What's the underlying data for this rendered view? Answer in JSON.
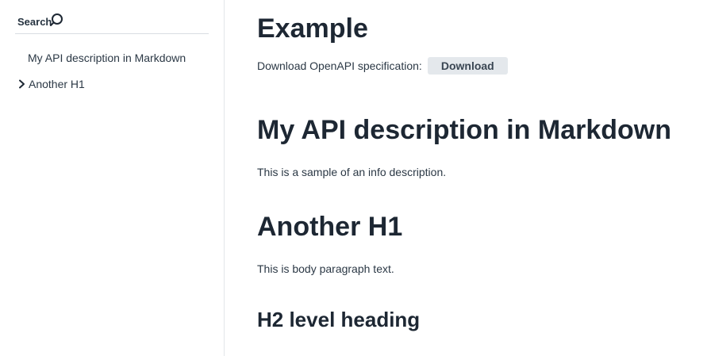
{
  "sidebar": {
    "search_label": "Search",
    "search_icon": "search-icon",
    "items": [
      {
        "label": "My API description in Markdown",
        "expandable": false
      },
      {
        "label": "Another H1",
        "expandable": true,
        "icon": "chevron-right-icon"
      }
    ]
  },
  "main": {
    "title": "Example",
    "download_text": "Download OpenAPI specification:",
    "download_button": "Download",
    "sections": [
      {
        "heading": "My API description in Markdown",
        "body": "This is a sample of an info description."
      },
      {
        "heading": "Another H1",
        "body": "This is body paragraph text."
      }
    ],
    "subheading": "H2 level heading"
  },
  "colors": {
    "heading": "#1d2733",
    "text": "#2b3845",
    "button_bg": "#e4e8ec",
    "divider": "#e3e6ea"
  }
}
